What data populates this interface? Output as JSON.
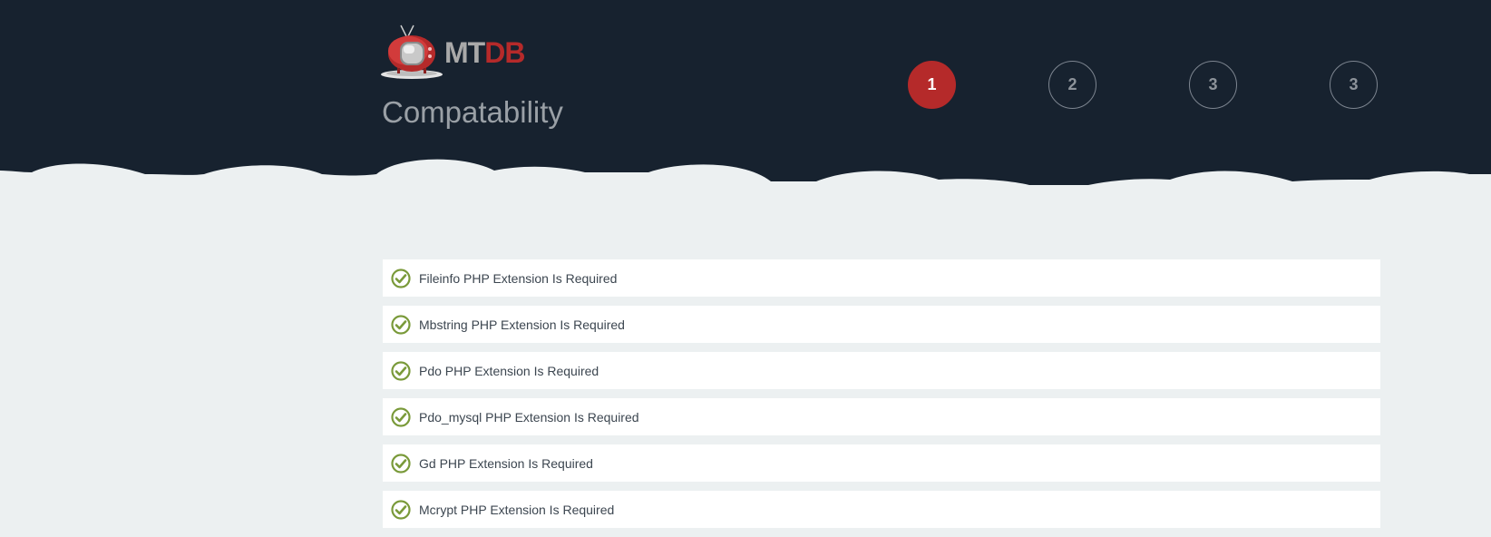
{
  "brand": {
    "logo_mt": "MT",
    "logo_db": "DB"
  },
  "page": {
    "title": "Compatability"
  },
  "steps": [
    {
      "label": "1",
      "active": true
    },
    {
      "label": "2",
      "active": false
    },
    {
      "label": "3",
      "active": false
    },
    {
      "label": "3",
      "active": false
    }
  ],
  "checks": [
    {
      "label": "Fileinfo PHP Extension Is Required",
      "status": "passed"
    },
    {
      "label": "Mbstring PHP Extension Is Required",
      "status": "passed"
    },
    {
      "label": "Pdo PHP Extension Is Required",
      "status": "passed"
    },
    {
      "label": "Pdo_mysql PHP Extension Is Required",
      "status": "passed"
    },
    {
      "label": "Gd PHP Extension Is Required",
      "status": "passed"
    },
    {
      "label": "Mcrypt PHP Extension Is Required",
      "status": "passed"
    }
  ],
  "colors": {
    "header_bg": "#17222f",
    "page_bg": "#ecf0f1",
    "accent": "#b52a2a",
    "check_green": "#7a9a3a"
  },
  "icons": {
    "logo": "tv-icon",
    "check": "check-circle-icon"
  }
}
